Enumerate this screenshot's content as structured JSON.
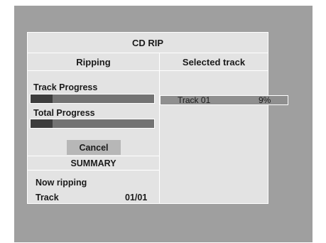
{
  "dialog": {
    "title": "CD RIP",
    "left_header": "Ripping",
    "right_header": "Selected track"
  },
  "progress": {
    "track_label": "Track Progress",
    "track_value": 0.18,
    "total_label": "Total Progress",
    "total_value": 0.18
  },
  "cancel_label": "Cancel",
  "summary": {
    "title": "SUMMARY",
    "now_ripping": "Now ripping",
    "track_label": "Track",
    "track_value": "01/01"
  },
  "selected_tracks": [
    {
      "name": "Track 01",
      "percent": "9%"
    }
  ],
  "colors": {
    "screen_bg": "#9f9f9f",
    "panel_bg": "#e3e3e3",
    "bar_bg": "#737373",
    "bar_fill": "#3d3d3d",
    "button_bg": "#b7b7b7",
    "row_highlight": "#8f8f8f"
  }
}
